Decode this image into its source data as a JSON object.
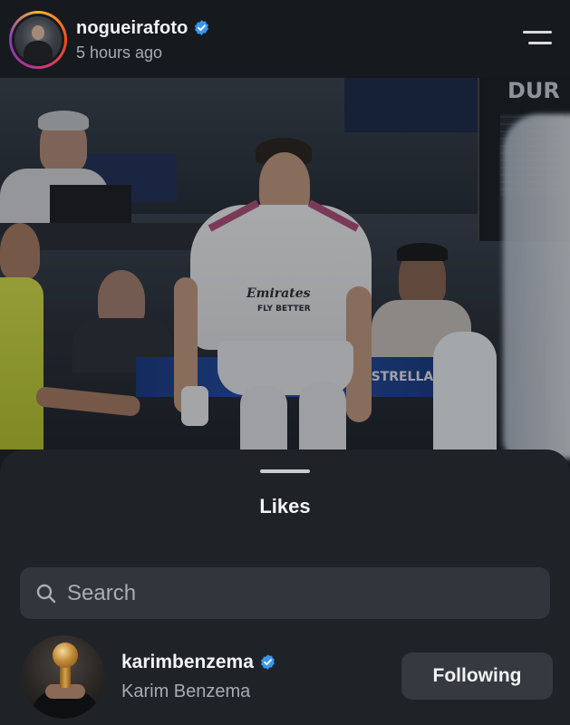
{
  "post": {
    "username": "nogueirafoto",
    "timestamp": "5 hours ago",
    "verified_icon": "verified-badge-icon",
    "menu_icon": "menu-icon"
  },
  "photo": {
    "description_alt": "",
    "board_text_top": "DUR",
    "board_text_ad": "ESTRELLA",
    "shirt_text": "Emirates",
    "shirt_subtext": "FLY BETTER"
  },
  "sheet": {
    "title": "Likes",
    "search": {
      "placeholder": "Search",
      "value": "",
      "icon": "search-icon"
    },
    "likes": [
      {
        "username": "karimbenzema",
        "full_name": "Karim Benzema",
        "verified": true,
        "button_label": "Following"
      }
    ]
  },
  "colors": {
    "background": "#15181d",
    "sheet": "#1f2227",
    "search_field": "#32363c",
    "verified": "#3897f0",
    "button": "#363a40",
    "secondary_text": "#a7abb2"
  }
}
